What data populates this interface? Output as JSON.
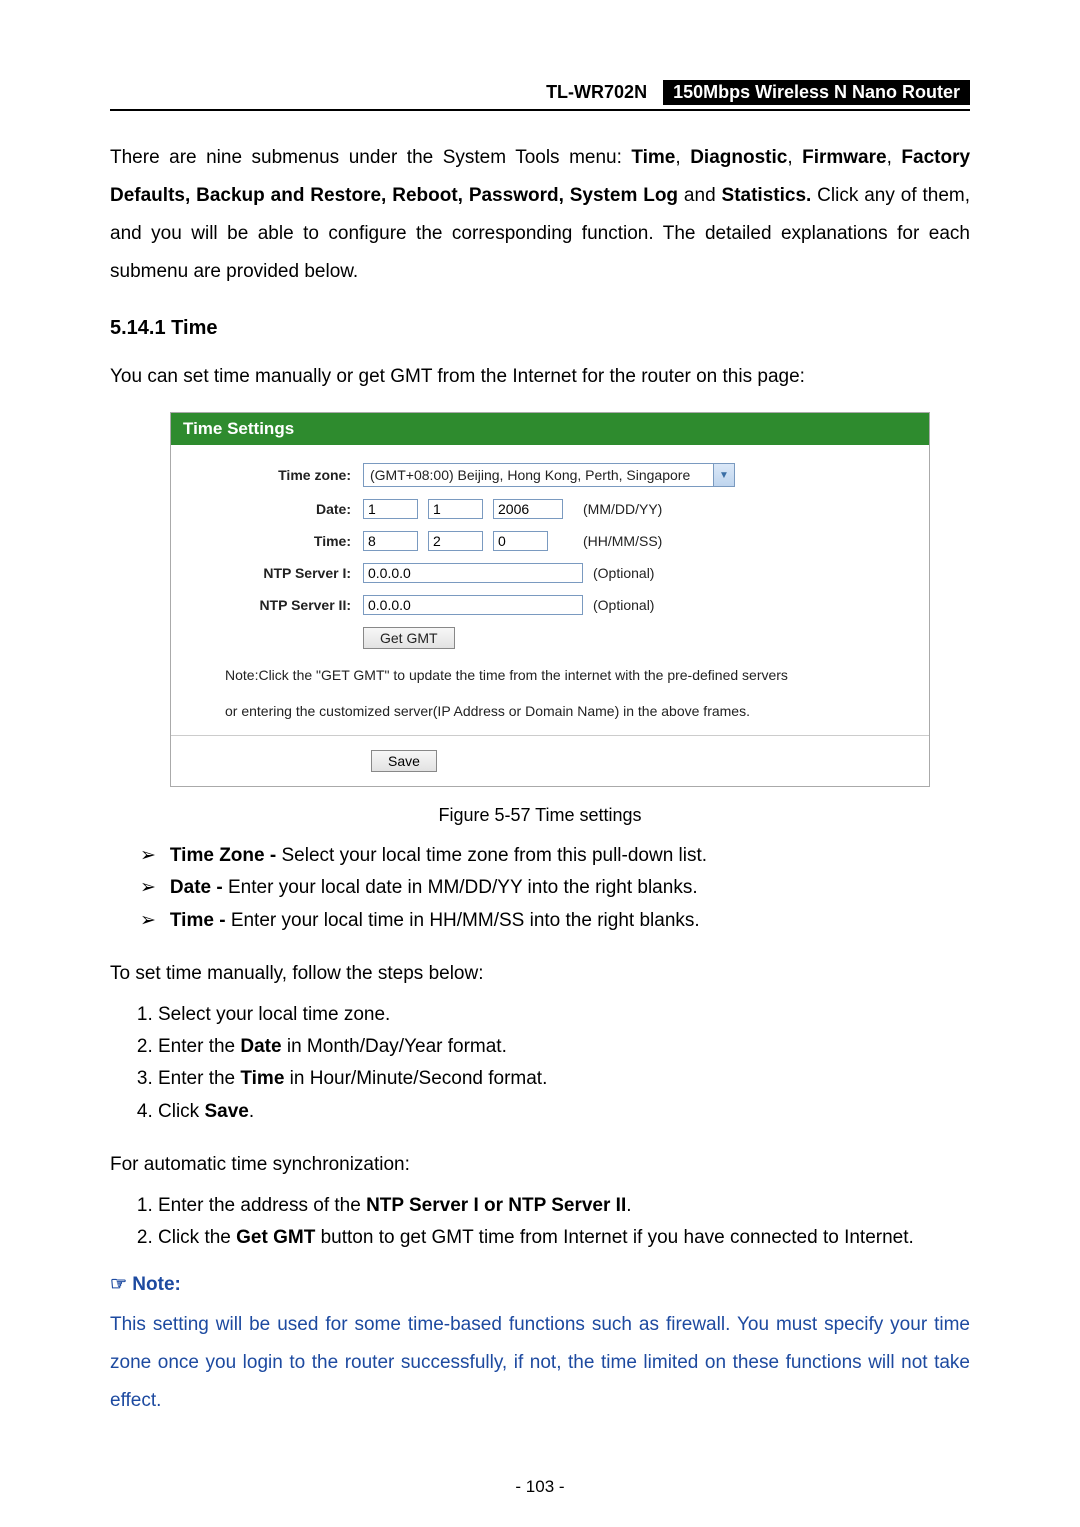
{
  "header": {
    "model": "TL-WR702N",
    "description": "150Mbps Wireless N Nano Router"
  },
  "intro_para": {
    "p1a": "There are nine submenus under the System Tools menu: ",
    "p1b": "Time",
    "p1c": ", ",
    "p1d": "Diagnostic",
    "p1e": ", ",
    "p1f": "Firmware",
    "p1g": ", ",
    "p1h": "Factory Defaults, Backup and Restore, Reboot, Password, System Log",
    "p1i": " and ",
    "p1j": "Statistics.",
    "p1k": " Click any of them, and you will be able to configure the corresponding function. The detailed explanations for each submenu are provided below."
  },
  "section": {
    "num_title": "5.14.1  Time",
    "lead": "You can set time manually or get GMT from the Internet for the router on this page:"
  },
  "panel": {
    "title": "Time Settings",
    "labels": {
      "timezone": "Time zone:",
      "date": "Date:",
      "time": "Time:",
      "ntp1": "NTP Server I:",
      "ntp2": "NTP Server II:"
    },
    "timezone_value": "(GMT+08:00) Beijing, Hong Kong, Perth, Singapore",
    "date": {
      "m": "1",
      "d": "1",
      "y": "2006",
      "suffix": "(MM/DD/YY)"
    },
    "time": {
      "h": "8",
      "m": "2",
      "s": "0",
      "suffix": "(HH/MM/SS)"
    },
    "ntp1_value": "0.0.0.0",
    "ntp2_value": "0.0.0.0",
    "optional": "(Optional)",
    "get_gmt": "Get GMT",
    "note_line1": "Note:Click the \"GET GMT\" to update the time from the internet with the pre-defined servers",
    "note_line2": "or entering the customized server(IP Address or Domain Name) in the above frames.",
    "save": "Save"
  },
  "caption": "Figure 5-57 Time settings",
  "bullets": {
    "b1a": "Time Zone - ",
    "b1b": "Select your local time zone from this pull-down list.",
    "b2a": "Date - ",
    "b2b": "Enter your local date in MM/DD/YY into the right blanks.",
    "b3a": "Time - ",
    "b3b": "Enter your local time in HH/MM/SS into the right blanks."
  },
  "manual_intro": "To set time manually, follow the steps below:",
  "manual_steps": {
    "s1": "Select your local time zone.",
    "s2a": "Enter the ",
    "s2b": "Date",
    "s2c": " in Month/Day/Year format.",
    "s3a": "Enter the ",
    "s3b": "Time",
    "s3c": " in Hour/Minute/Second format.",
    "s4a": "Click ",
    "s4b": "Save",
    "s4c": "."
  },
  "auto_intro": "For automatic time synchronization:",
  "auto_steps": {
    "a1a": "Enter the address of the ",
    "a1b": "NTP Server I or NTP Server II",
    "a1c": ".",
    "a2a": "Click the ",
    "a2b": "Get GMT",
    "a2c": " button to get GMT time from Internet if you have connected to Internet."
  },
  "note": {
    "head": "☞  Note:",
    "body": "This setting will be used for some time-based functions such as firewall. You must specify your time zone once you login to the router successfully, if not, the time limited on these functions will not take effect."
  },
  "page_number": "- 103 -"
}
